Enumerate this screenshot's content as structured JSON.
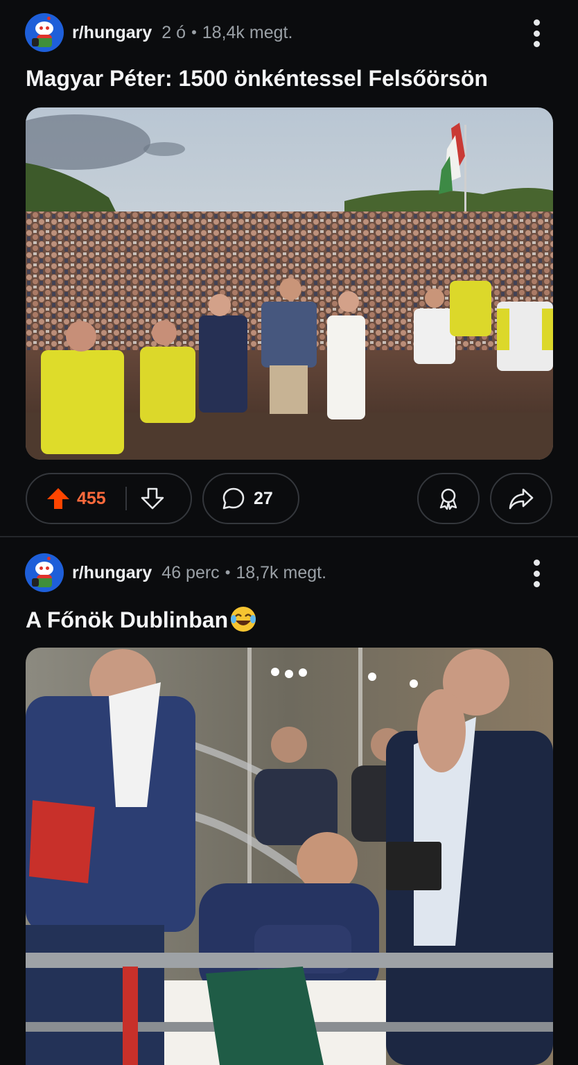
{
  "feed": {
    "posts": [
      {
        "subreddit": "r/hungary",
        "age": "2 ó",
        "views": "18,4k megt.",
        "title": "Magyar Péter: 1500 önkéntessel Felsőörsön",
        "upvotes": "455",
        "comments": "27",
        "vote_state": "upvoted",
        "accent": "#ff4500"
      },
      {
        "subreddit": "r/hungary",
        "age": "46 perc",
        "views": "18,7k megt.",
        "title": "A Főnök Dublinban",
        "title_emoji": "face-with-tears-of-joy"
      }
    ],
    "icons": {
      "overflow": "kebab-menu-icon",
      "upvote": "upvote-arrow-icon",
      "downvote": "downvote-arrow-icon",
      "comment": "comment-bubble-icon",
      "award": "award-ribbon-icon",
      "share": "share-arrow-icon"
    }
  }
}
